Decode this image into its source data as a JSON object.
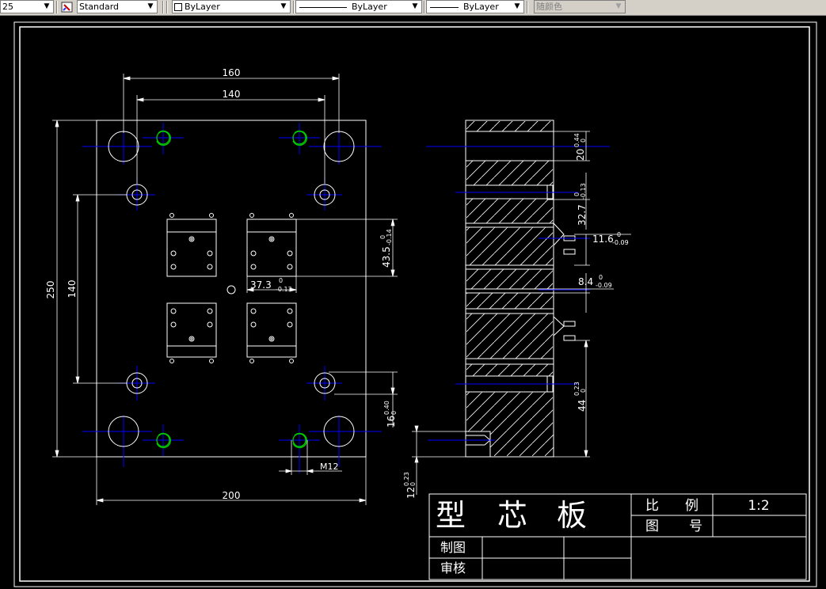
{
  "toolbar": {
    "dimstyle_value": "25",
    "textstyle_value": "Standard",
    "layer_value": "ByLayer",
    "linetype_value": "ByLayer",
    "lineweight_value": "ByLayer",
    "color_value": "随颜色",
    "icon": "text-style-icon"
  },
  "drawing": {
    "dim_160": "160",
    "dim_140_top": "140",
    "dim_250": "250",
    "dim_140_left": "140",
    "dim_200": "200",
    "dim_435": "43.5",
    "dim_435_tol_up": "0",
    "dim_435_tol_dn": "-0.14",
    "dim_373": "37.3",
    "dim_373_tol_up": "0",
    "dim_373_tol_dn": "-0.13",
    "dim_16": "16",
    "dim_16_tol_up": "0.40",
    "dim_16_tol_dn": "0",
    "dim_m12": "M12",
    "dim_12": "12",
    "dim_12_tol_up": "0.23",
    "dim_12_tol_dn": "0",
    "dim_20": "20",
    "dim_20_tol_up": "0.44",
    "dim_20_tol_dn": "0",
    "dim_327": "32.7",
    "dim_327_tol_up": "0",
    "dim_327_tol_dn": "-0.13",
    "dim_116": "11.6",
    "dim_116_tol_up": "0",
    "dim_116_tol_dn": "-0.09",
    "dim_84": "8.4",
    "dim_84_tol_up": "0",
    "dim_84_tol_dn": "-0.09",
    "dim_44": "44",
    "dim_44_tol_up": "0.23",
    "dim_44_tol_dn": "0"
  },
  "title_block": {
    "part_name_1": "型",
    "part_name_2": "芯",
    "part_name_3": "板",
    "scale_label_1": "比",
    "scale_label_2": "例",
    "scale_value": "1:2",
    "drawing_no_label_1": "图",
    "drawing_no_label_2": "号",
    "drawn_by_label": "制图",
    "checked_by_label": "审核"
  },
  "colors": {
    "background": "#000000",
    "lines": "#ffffff",
    "center_lines": "#0000ff",
    "highlight": "#00cc00"
  }
}
